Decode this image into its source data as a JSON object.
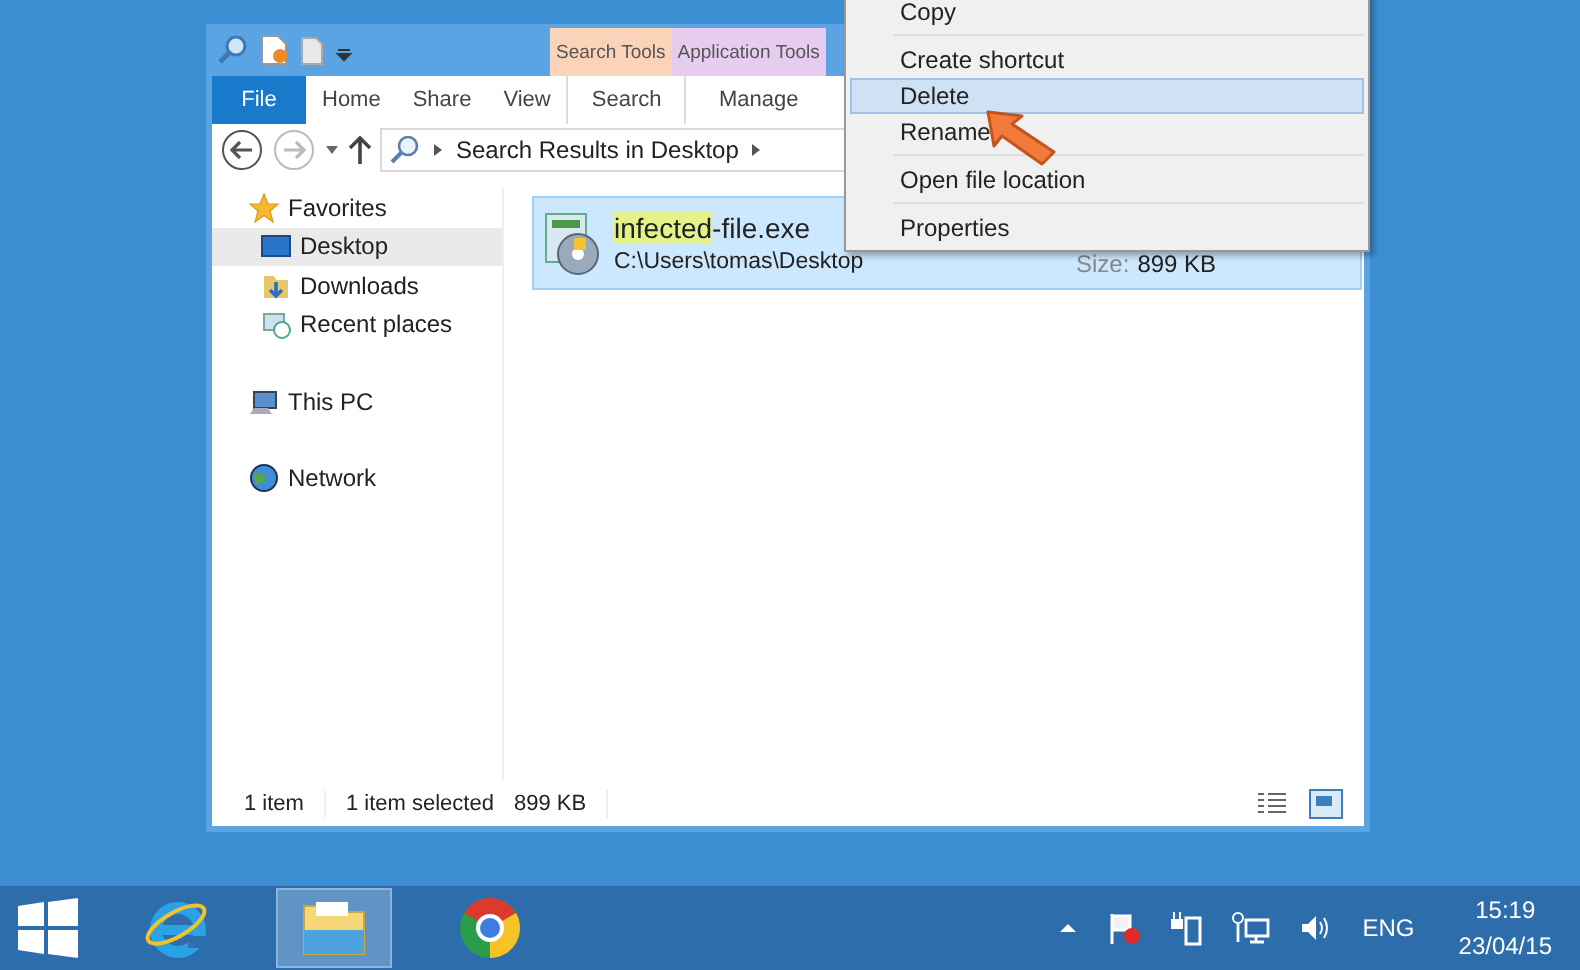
{
  "ribbon": {
    "context_groups": [
      {
        "label": "Search Tools",
        "color": "#fad3b8"
      },
      {
        "label": "Application Tools",
        "color": "#e6cdf0"
      }
    ],
    "tabs": [
      {
        "label": "File",
        "kind": "file"
      },
      {
        "label": "Home",
        "kind": "plain"
      },
      {
        "label": "Share",
        "kind": "plain"
      },
      {
        "label": "View",
        "kind": "plain"
      },
      {
        "label": "Search",
        "kind": "contextual"
      },
      {
        "label": "Manage",
        "kind": "contextual"
      }
    ]
  },
  "address_bar": {
    "path": "Search Results in Desktop"
  },
  "navigation": [
    {
      "label": "Favorites",
      "kind": "star",
      "children": [
        {
          "label": "Desktop",
          "kind": "desktop",
          "selected": true
        },
        {
          "label": "Downloads",
          "kind": "downloads",
          "selected": false
        },
        {
          "label": "Recent places",
          "kind": "recent",
          "selected": false
        }
      ]
    },
    {
      "label": "This PC",
      "kind": "pc"
    },
    {
      "label": "Network",
      "kind": "network"
    }
  ],
  "results": [
    {
      "match": "infected",
      "rest": "-file.exe",
      "path": "C:\\Users\\tomas\\Desktop",
      "size_label": "Size:",
      "size": "899 KB",
      "selected": true
    }
  ],
  "status_bar": {
    "count": "1 item",
    "selection": "1 item selected",
    "size": "899 KB"
  },
  "context_menu": [
    {
      "label": "Copy",
      "selected": false,
      "separator_after": true
    },
    {
      "label": "Create shortcut",
      "selected": false,
      "separator_after": false
    },
    {
      "label": "Delete",
      "selected": true,
      "separator_after": false
    },
    {
      "label": "Rename",
      "selected": false,
      "separator_after": true
    },
    {
      "label": "Open file location",
      "selected": false,
      "separator_after": true
    },
    {
      "label": "Properties",
      "selected": false,
      "separator_after": false
    }
  ],
  "taskbar": {
    "apps": [
      {
        "kind": "ie",
        "active": false
      },
      {
        "kind": "explorer",
        "active": true
      },
      {
        "kind": "chrome",
        "active": false
      }
    ],
    "language": "ENG",
    "time": "15:19",
    "date": "23/04/15"
  }
}
